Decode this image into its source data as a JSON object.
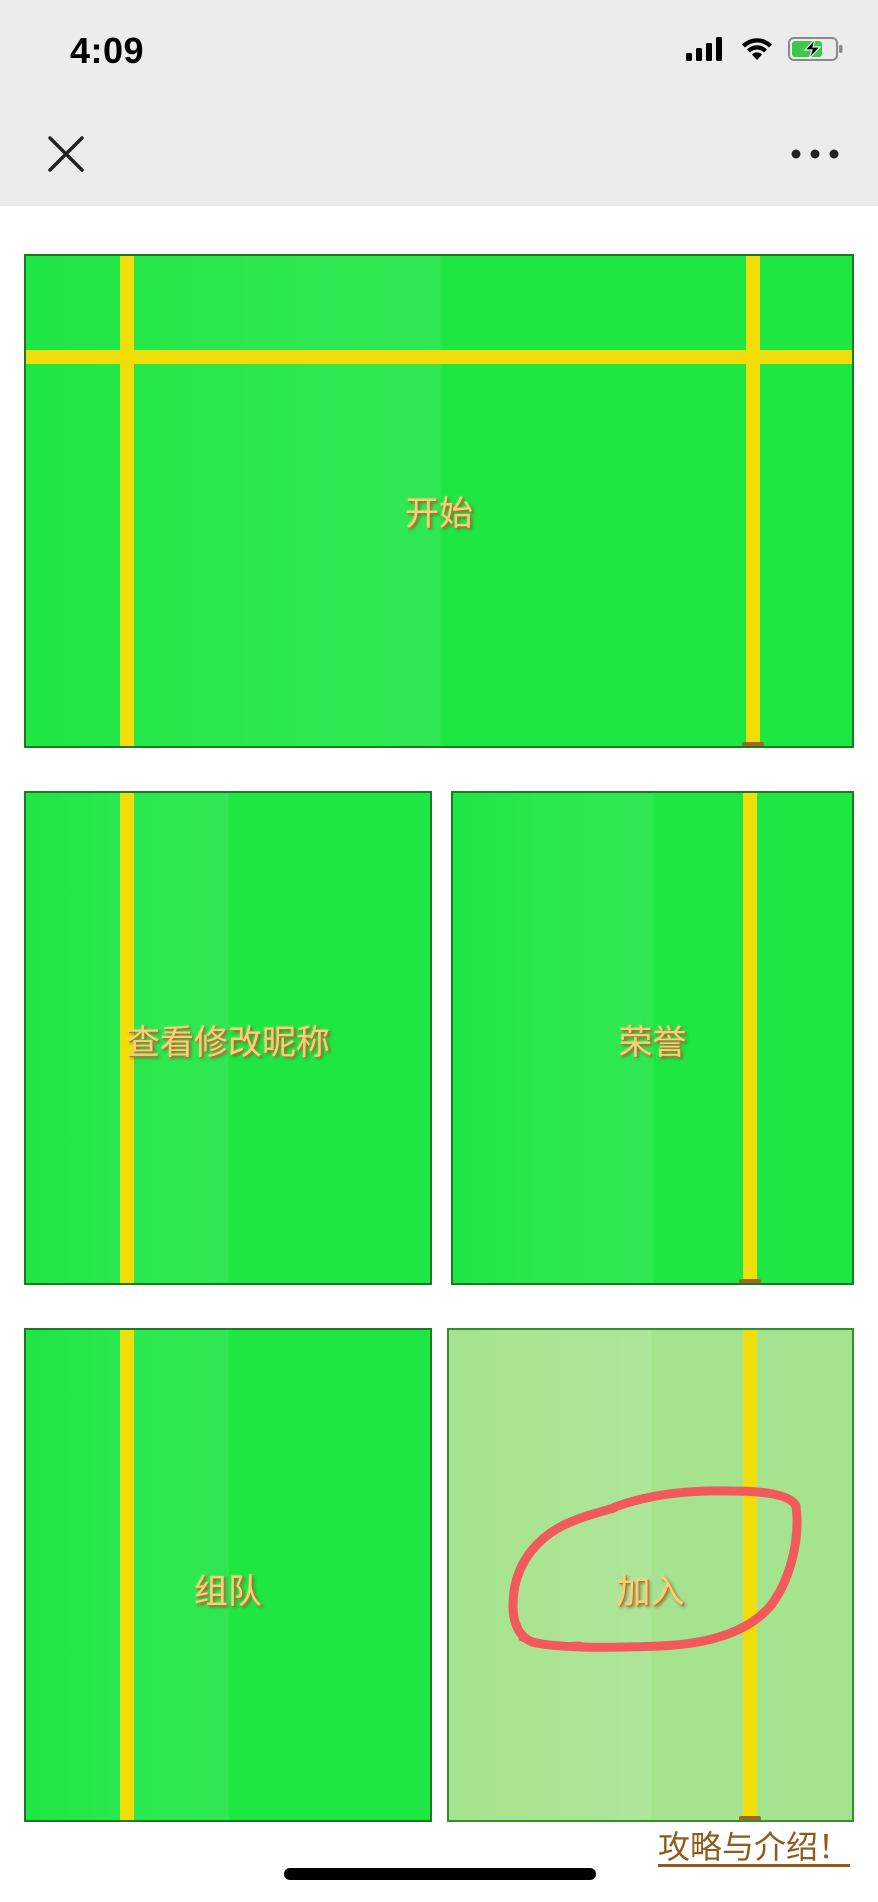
{
  "status_bar": {
    "time": "4:09",
    "icons": [
      "signal-icon",
      "wifi-icon",
      "battery-charging-icon"
    ]
  },
  "nav_bar": {
    "icons": [
      "close-icon",
      "more-icon"
    ]
  },
  "tiles": {
    "start": {
      "label": "开始"
    },
    "nickname": {
      "label": "查看修改昵称"
    },
    "honor": {
      "label": "荣誉"
    },
    "team": {
      "label": "组队"
    },
    "join": {
      "label": "加入"
    }
  },
  "footer": {
    "guide_link": "攻略与介绍！"
  },
  "colors": {
    "tile_green": "#1ee643",
    "tile_light_green": "#a5e38e",
    "goalpost_yellow": "#f0de0b",
    "label_gold": "#f3d27a",
    "annotation_red": "#f25a5a",
    "link_brown": "#8f5a1a"
  }
}
